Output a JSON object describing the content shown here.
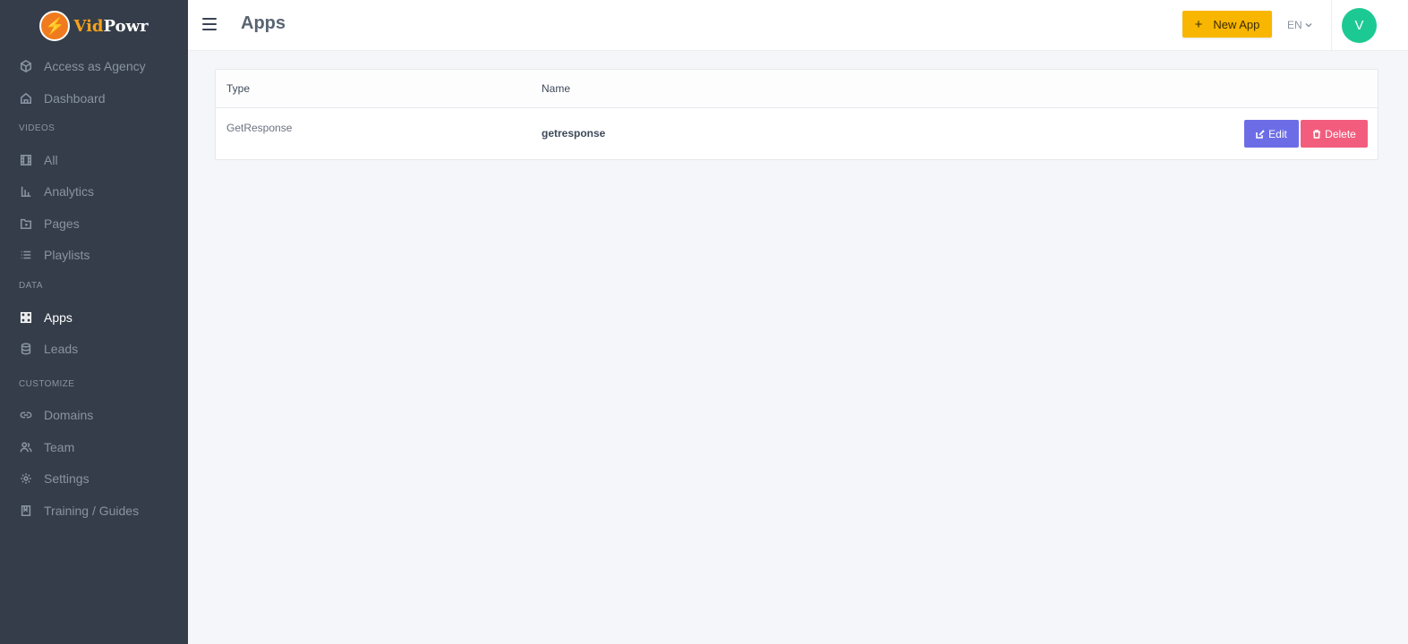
{
  "brand": {
    "name_part1": "Vid",
    "name_part2": "Powr"
  },
  "sidebar": {
    "items": [
      {
        "label": "Access as Agency",
        "icon": "cube-icon"
      },
      {
        "label": "Dashboard",
        "icon": "home-icon"
      },
      {
        "label": "All",
        "icon": "film-icon"
      },
      {
        "label": "Analytics",
        "icon": "bar-chart-icon"
      },
      {
        "label": "Pages",
        "icon": "folder-icon"
      },
      {
        "label": "Playlists",
        "icon": "list-icon"
      },
      {
        "label": "Apps",
        "icon": "grid-icon",
        "active": true
      },
      {
        "label": "Leads",
        "icon": "database-icon"
      },
      {
        "label": "Domains",
        "icon": "link-icon"
      },
      {
        "label": "Team",
        "icon": "users-icon"
      },
      {
        "label": "Settings",
        "icon": "gear-icon"
      },
      {
        "label": "Training / Guides",
        "icon": "book-icon"
      }
    ],
    "sections": {
      "videos": "VIDEOS",
      "data": "DATA",
      "customize": "CUSTOMIZE"
    }
  },
  "header": {
    "title": "Apps",
    "new_app_label": "New App",
    "new_app_icon": "+",
    "language": "EN",
    "avatar_initial": "V"
  },
  "table": {
    "columns": [
      "Type",
      "Name"
    ],
    "rows": [
      {
        "type": "GetResponse",
        "name": "getresponse"
      }
    ],
    "edit_label": "Edit",
    "delete_label": "Delete"
  },
  "colors": {
    "sidebar_bg": "#353d4a",
    "accent_yellow": "#f9b600",
    "edit_purple": "#6c6de6",
    "delete_pink": "#f25d7e",
    "avatar_green": "#1dc993"
  }
}
